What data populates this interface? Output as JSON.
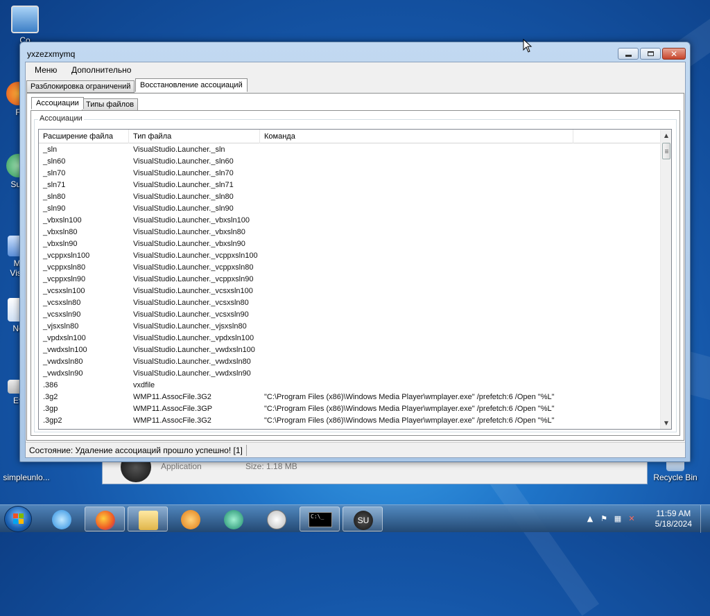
{
  "desktop": {
    "icons": [
      {
        "label": "Co"
      },
      {
        "label": "F"
      },
      {
        "label": "Sup"
      },
      {
        "label": "Mi"
      },
      {
        "label": "Visu"
      },
      {
        "label": "No"
      },
      {
        "label": "Ev"
      },
      {
        "label": "simpleunlo..."
      },
      {
        "label": "Recycle Bin"
      }
    ],
    "background_window": {
      "type_text": "Application",
      "size_text": "Size: 1.18 MB"
    }
  },
  "window": {
    "title": "yxzezxmymq",
    "menu": [
      "Меню",
      "Дополнительно"
    ],
    "top_tabs": [
      "Разблокировка ограничений",
      "Восстановление ассоциаций"
    ],
    "active_top_tab": 1,
    "sub_tabs": [
      "Ассоциации",
      "Типы файлов"
    ],
    "active_sub_tab": 0,
    "groupbox_label": "Ассоциации",
    "columns": [
      "Расширение файла",
      "Тип файла",
      "Команда",
      ""
    ],
    "rows": [
      [
        "_sln",
        "VisualStudio.Launcher._sln",
        ""
      ],
      [
        "_sln60",
        "VisualStudio.Launcher._sln60",
        ""
      ],
      [
        "_sln70",
        "VisualStudio.Launcher._sln70",
        ""
      ],
      [
        "_sln71",
        "VisualStudio.Launcher._sln71",
        ""
      ],
      [
        "_sln80",
        "VisualStudio.Launcher._sln80",
        ""
      ],
      [
        "_sln90",
        "VisualStudio.Launcher._sln90",
        ""
      ],
      [
        "_vbxsln100",
        "VisualStudio.Launcher._vbxsln100",
        ""
      ],
      [
        "_vbxsln80",
        "VisualStudio.Launcher._vbxsln80",
        ""
      ],
      [
        "_vbxsln90",
        "VisualStudio.Launcher._vbxsln90",
        ""
      ],
      [
        "_vcppxsln100",
        "VisualStudio.Launcher._vcppxsln100",
        ""
      ],
      [
        "_vcppxsln80",
        "VisualStudio.Launcher._vcppxsln80",
        ""
      ],
      [
        "_vcppxsln90",
        "VisualStudio.Launcher._vcppxsln90",
        ""
      ],
      [
        "_vcsxsln100",
        "VisualStudio.Launcher._vcsxsln100",
        ""
      ],
      [
        "_vcsxsln80",
        "VisualStudio.Launcher._vcsxsln80",
        ""
      ],
      [
        "_vcsxsln90",
        "VisualStudio.Launcher._vcsxsln90",
        ""
      ],
      [
        "_vjsxsln80",
        "VisualStudio.Launcher._vjsxsln80",
        ""
      ],
      [
        "_vpdxsln100",
        "VisualStudio.Launcher._vpdxsln100",
        ""
      ],
      [
        "_vwdxsln100",
        "VisualStudio.Launcher._vwdxsln100",
        ""
      ],
      [
        "_vwdxsln80",
        "VisualStudio.Launcher._vwdxsln80",
        ""
      ],
      [
        "_vwdxsln90",
        "VisualStudio.Launcher._vwdxsln90",
        ""
      ],
      [
        ".386",
        "vxdfile",
        ""
      ],
      [
        ".3g2",
        "WMP11.AssocFile.3G2",
        "\"C:\\Program Files (x86)\\Windows Media Player\\wmplayer.exe\" /prefetch:6 /Open \"%L\""
      ],
      [
        ".3gp",
        "WMP11.AssocFile.3GP",
        "\"C:\\Program Files (x86)\\Windows Media Player\\wmplayer.exe\" /prefetch:6 /Open \"%L\""
      ],
      [
        ".3gp2",
        "WMP11.AssocFile.3G2",
        "\"C:\\Program Files (x86)\\Windows Media Player\\wmplayer.exe\" /prefetch:6 /Open \"%L\""
      ]
    ],
    "status": "Состояние: Удаление ассоциаций прошло успешно! [1]"
  },
  "taskbar": {
    "clock_time": "11:59 AM",
    "clock_date": "5/18/2024",
    "buttons": [
      "internet-explorer",
      "firefox",
      "file-explorer",
      "media-player",
      "app-green",
      "clock-app",
      "command-prompt",
      "simpleunlocker"
    ],
    "cmd_text": "C:\\_"
  }
}
